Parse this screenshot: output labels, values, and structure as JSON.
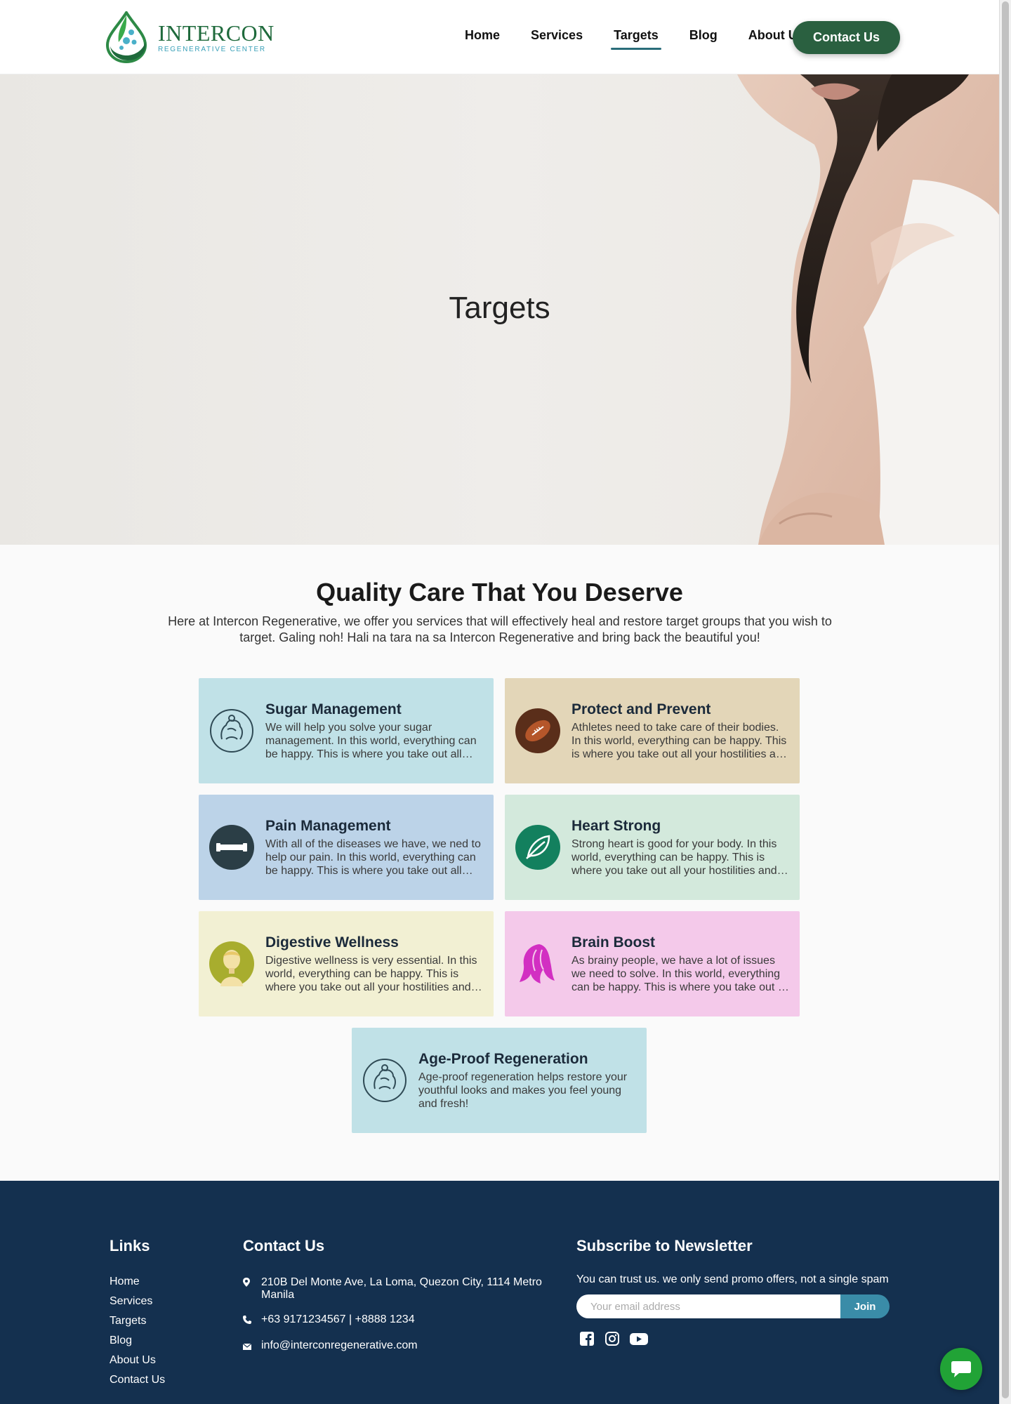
{
  "header": {
    "logo_name": "INTERCON",
    "logo_sub": "REGENERATIVE CENTER",
    "nav": [
      "Home",
      "Services",
      "Targets",
      "Blog",
      "About Us"
    ],
    "active_nav": "Targets",
    "contact_button": "Contact Us"
  },
  "hero": {
    "title": "Targets"
  },
  "intro": {
    "title": "Quality Care That You Deserve",
    "description": "Here at Intercon Regenerative, we offer you services that will effectively heal and restore target groups that you wish to target. Galing noh! Hali na tara na sa Intercon Regenerative and bring back the beautiful you!"
  },
  "cards": [
    {
      "title": "Sugar Management",
      "text": "We will help you solve your sugar management. In this world, everything can be happy. This is where you take out all your hostilities and frustrations.",
      "color": "#c0e1e7",
      "icon": "muscle-figure-icon"
    },
    {
      "title": "Protect and Prevent",
      "text": "Athletes need to take care of their bodies. In this world, everything can be happy. This is where you take out all your hostilities and frustrations.",
      "color": "#e3d6b8",
      "icon": "football-icon"
    },
    {
      "title": "Pain Management",
      "text": "With all of the diseases we have, we ned to help our pain. In this world, everything can be happy. This is where you take out all your hostilities and frustrations.",
      "color": "#bcd3e8",
      "icon": "dumbbell-icon"
    },
    {
      "title": "Heart Strong",
      "text": "Strong heart is good for your body. In this world, everything can be happy. This is where you take out all your hostilities and frustrations.",
      "color": "#d3e9dc",
      "icon": "leaf-icon"
    },
    {
      "title": "Digestive Wellness",
      "text": "Digestive wellness is very essential. In this world, everything can be happy. This is where you take out all your hostilities and frustrations.",
      "color": "#f2f0d3",
      "icon": "person-avatar-icon"
    },
    {
      "title": "Brain Boost",
      "text": "As brainy people, we have a lot of issues we need to solve. In this world, everything can be happy. This is where you take out all your hostilities and frustrations.",
      "color": "#f4c9ea",
      "icon": "hair-silhouette-icon"
    },
    {
      "title": "Age-Proof Regeneration",
      "text": "Age-proof regeneration helps restore your youthful looks and makes you feel young and fresh!",
      "color": "#c0e1e7",
      "icon": "muscle-figure-icon"
    }
  ],
  "footer": {
    "links_title": "Links",
    "links": [
      "Home",
      "Services",
      "Targets",
      "Blog",
      "About Us",
      "Contact Us"
    ],
    "contact_title": "Contact Us",
    "address": "210B Del Monte Ave, La Loma, Quezon City, 1114 Metro Manila",
    "phone": "+63 9171234567 | +8888 1234",
    "email": "info@interconregenerative.com",
    "newsletter_title": "Subscribe to Newsletter",
    "newsletter_text": "You can trust us. we only send promo offers, not a single spam",
    "email_placeholder": "Your email address",
    "join_label": "Join",
    "social": [
      "facebook-icon",
      "instagram-icon",
      "youtube-icon"
    ]
  },
  "colors": {
    "brand_green": "#2a6040",
    "footer_bg": "#14304f",
    "accent_blue": "#3a8ca8",
    "chat_green": "#21a336"
  }
}
